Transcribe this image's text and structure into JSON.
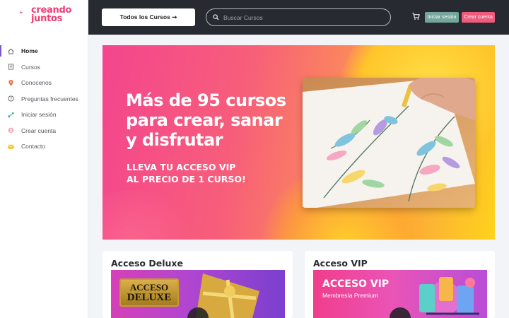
{
  "brand": {
    "line1": "creando",
    "line2": "juntos",
    "color": "#ef3d74"
  },
  "sidebar": {
    "items": [
      {
        "label": "Home",
        "icon": "home-icon",
        "active": true
      },
      {
        "label": "Cursos",
        "icon": "book-icon"
      },
      {
        "label": "Conocenos",
        "icon": "location-pin-icon"
      },
      {
        "label": "Preguntas frecuentes",
        "icon": "question-circle-icon"
      },
      {
        "label": "Iniciar sesión",
        "icon": "share-icon"
      },
      {
        "label": "Crear cuenta",
        "icon": "user-circle-icon"
      },
      {
        "label": "Contacto",
        "icon": "envelope-icon"
      }
    ]
  },
  "header": {
    "courses_button": "Todos los Cursos ➞",
    "search_placeholder": "Buscar Cursos",
    "login_label": "Iniciar sesión",
    "signup_label": "Crear cuenta",
    "cart_icon": "cart-icon"
  },
  "banner": {
    "title_lines": [
      "Más de 95 cursos",
      "para crear, sanar",
      "y disfrutar"
    ],
    "subtitle_lines": [
      "LLEVA TU ACCESO VIP",
      "AL PRECIO DE  1 CURSO!"
    ]
  },
  "cards": {
    "deluxe": {
      "title": "Acceso Deluxe",
      "badge_line1": "ACCESO",
      "badge_line2": "DELUXE"
    },
    "vip": {
      "title": "Acceso VIP",
      "banner_title": "ACCESO VIP",
      "banner_sub": "Membresía Premium"
    }
  },
  "colors": {
    "header_bg": "#272a30",
    "login_btn": "#74a69b",
    "signup_btn": "#ef5a7d",
    "active_indicator": "#7b57c9"
  }
}
